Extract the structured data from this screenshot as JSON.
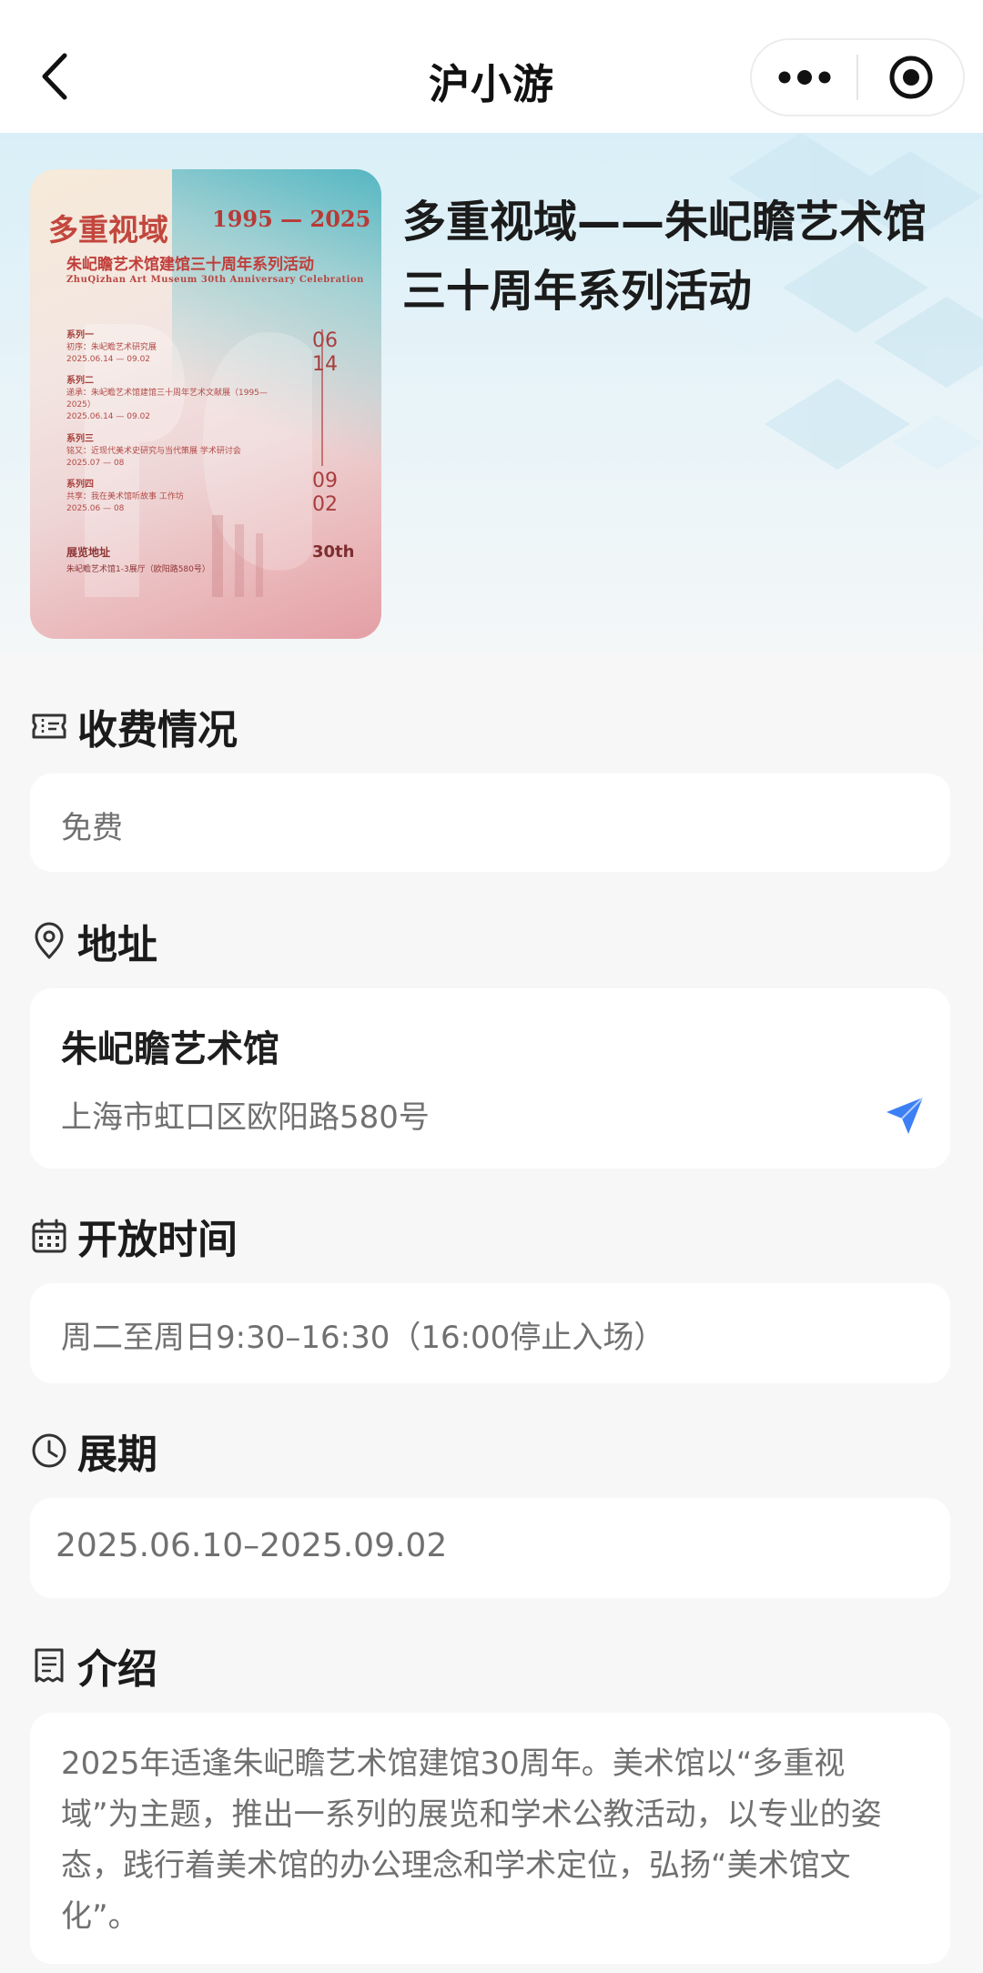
{
  "navbar": {
    "title": "沪小游",
    "back_icon": "chevron-left-icon",
    "more_icon": "more-dots-icon",
    "close_icon": "target-close-icon"
  },
  "hero": {
    "title": "多重视域——朱屺瞻艺术馆三十周年系列活动",
    "poster": {
      "headline": "多重视域",
      "years": "1995 — 2025",
      "subtitle": "朱屺瞻艺术馆建馆三十周年系列活动",
      "english": "ZhuQizhan Art Museum 30th Anniversary Celebration",
      "series": [
        {
          "label": "系列一",
          "desc": "初序：朱屺瞻艺术研究展",
          "date": "2025.06.14 — 09.02"
        },
        {
          "label": "系列二",
          "desc": "递承：朱屺瞻艺术馆建馆三十周年艺术文献展（1995—2025）",
          "date": "2025.06.14 — 09.02"
        },
        {
          "label": "系列三",
          "desc": "铭又：近现代美术史研究与当代策展 学术研讨会",
          "date": "2025.07 — 08"
        },
        {
          "label": "系列四",
          "desc": "共享：我在美术馆听故事 工作坊",
          "date": "2025.06 — 08"
        }
      ],
      "date_top_1": "06",
      "date_top_2": "14",
      "date_bottom_1": "09",
      "date_bottom_2": "02",
      "venue_label": "展览地址",
      "venue": "朱屺瞻艺术馆1-3展厅（欧阳路580号）",
      "badge": "30th"
    }
  },
  "sections": {
    "fee": {
      "icon": "ticket-icon",
      "title": "收费情况",
      "value": "免费"
    },
    "address": {
      "icon": "location-pin-icon",
      "title": "地址",
      "name": "朱屺瞻艺术馆",
      "line": "上海市虹口区欧阳路580号",
      "nav_icon": "navigate-arrow-icon"
    },
    "hours": {
      "icon": "calendar-icon",
      "title": "开放时间",
      "value": "周二至周日9:30–16:30（16:00停止入场）"
    },
    "period": {
      "icon": "clock-icon",
      "title": "展期",
      "value": "2025.06.10–2025.09.02"
    },
    "intro": {
      "icon": "document-icon",
      "title": "介绍",
      "text": "2025年适逢朱屺瞻艺术馆建馆30周年。美术馆以“多重视域”为主题，推出一系列的展览和学术公教活动，以专业的姿态，践行着美术馆的办公理念和学术定位，弘扬“美术馆文化”。"
    }
  },
  "colors": {
    "accent_blue": "#3d7ff5",
    "poster_red": "#c2463d",
    "hero_bg": "#d9eff7"
  }
}
